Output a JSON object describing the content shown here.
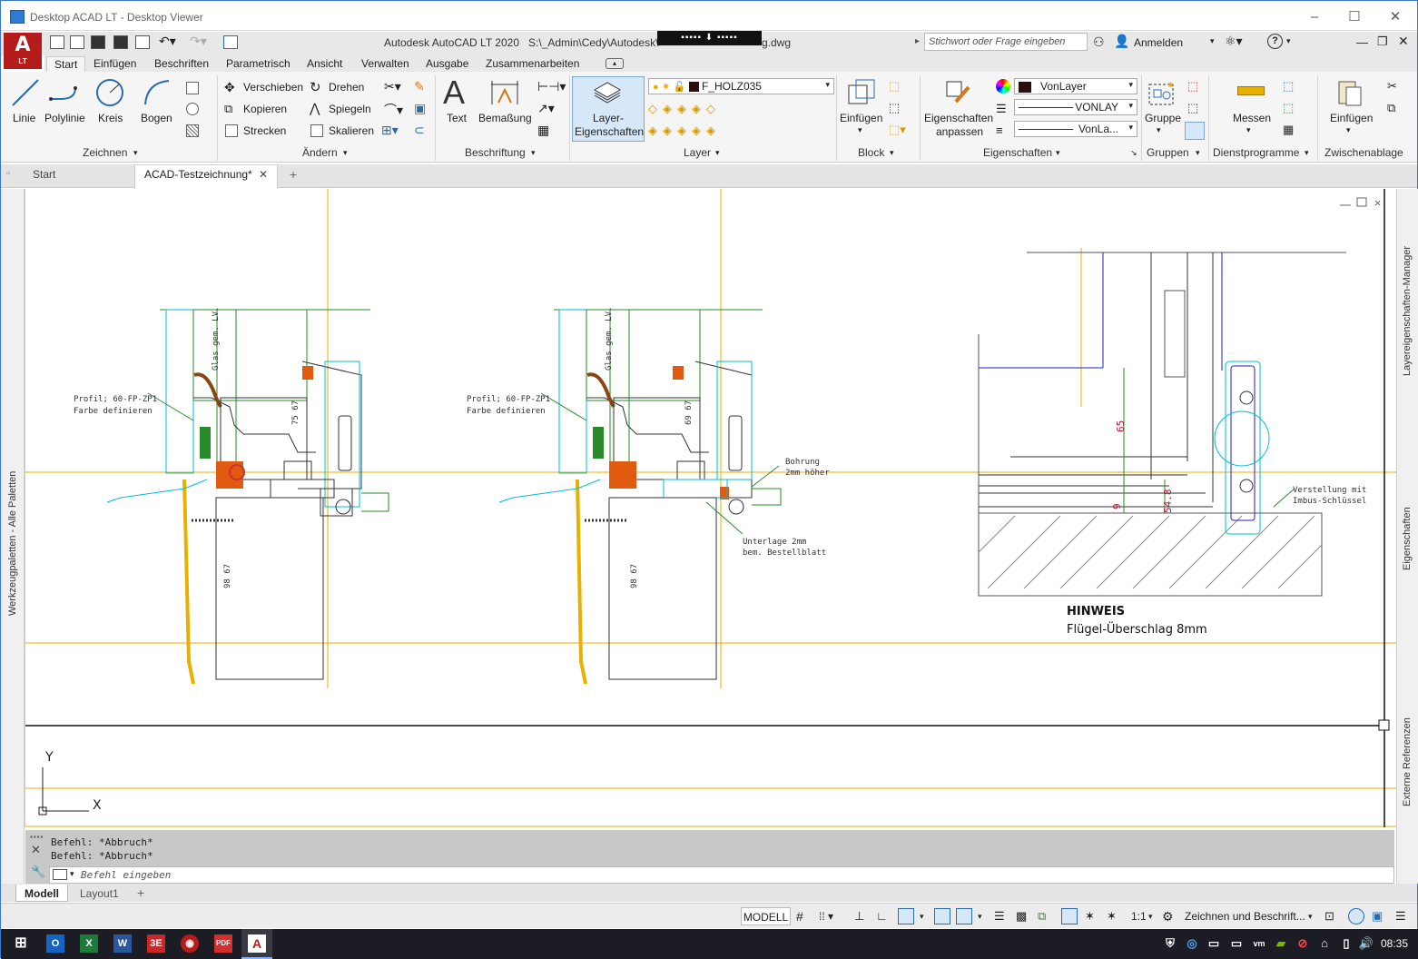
{
  "window": {
    "title": "Desktop ACAD LT - Desktop Viewer"
  },
  "app": {
    "logo_letter": "A",
    "logo_sub": "LT",
    "title": "Autodesk AutoCAD LT 2020",
    "path_left": "S:\\_Admin\\Cedy\\Autodesk\\",
    "path_right": "g.dwg",
    "overlay_bar": "▪▪▪▪▪ ⬇ ▪▪▪▪▪",
    "search_placeholder": "Stichwort oder Frage eingeben",
    "signin": "Anmelden",
    "help": "?"
  },
  "menu_tabs": [
    "Start",
    "Einfügen",
    "Beschriften",
    "Parametrisch",
    "Ansicht",
    "Verwalten",
    "Ausgabe",
    "Zusammenarbeiten"
  ],
  "ribbon": {
    "draw": {
      "items": [
        "Linie",
        "Polylinie",
        "Kreis",
        "Bogen"
      ],
      "panel": "Zeichnen"
    },
    "modify": {
      "items": [
        "Verschieben",
        "Drehen",
        "Kopieren",
        "Spiegeln",
        "Strecken",
        "Skalieren"
      ],
      "panel": "Ändern"
    },
    "annotation": {
      "items": [
        "Text",
        "Bemaßung"
      ],
      "panel": "Beschriftung"
    },
    "layer": {
      "button_line1": "Layer-",
      "button_line2": "Eigenschaften",
      "current_layer": "F_HOLZ035",
      "panel": "Layer"
    },
    "block": {
      "item": "Einfügen",
      "panel": "Block"
    },
    "properties": {
      "button_line1": "Eigenschaften",
      "button_line2": "anpassen",
      "color": "VonLayer",
      "linetype": "VONLAY",
      "lineweight": "VonLa...",
      "panel": "Eigenschaften"
    },
    "groups": {
      "item": "Gruppe",
      "panel": "Gruppen"
    },
    "utilities": {
      "item": "Messen",
      "panel": "Dienstprogramme"
    },
    "clipboard": {
      "item": "Einfügen",
      "panel": "Zwischenablage"
    }
  },
  "doc_tabs": [
    "Start",
    "ACAD-Testzeichnung*"
  ],
  "palettes": {
    "left": "Werkzeugpaletten - Alle Paletten",
    "right1": "Layereigenschaften-Manager",
    "right2": "Eigenschaften",
    "right3": "Externe Referenzen"
  },
  "drawing": {
    "glas1": "Glas gem. LV.",
    "glas2": "Glas gem. LV.",
    "profil_l1": "Profil; 60-FP-ZP1",
    "profil_l2": "Farbe definieren",
    "profil2_l1": "Profil; 60-FP-ZP1",
    "profil2_l2": "Farbe definieren",
    "bohrung_l1": "Bohrung",
    "bohrung_l2": "2mm höher",
    "unterlage_l1": "Unterlage 2mm",
    "unterlage_l2": "bem. Bestellblatt",
    "verstellung_l1": "Verstellung mit",
    "verstellung_l2": "Imbus-Schlüssel",
    "dim_65": "65",
    "dim_9": "9",
    "dim_548": "54.8",
    "hinweis_title": "HINWEIS",
    "hinweis_text": "Flügel-Überschlag 8mm",
    "dim_75_67": "75 67",
    "dim_69_67": "69 67",
    "dim_98_a": "98 67",
    "dim_98_b": "98 67",
    "axis_x": "X",
    "axis_y": "Y"
  },
  "command": {
    "history": [
      "Befehl: *Abbruch*",
      "Befehl: *Abbruch*"
    ],
    "placeholder": "Befehl eingeben"
  },
  "layout_tabs": [
    "Modell",
    "Layout1"
  ],
  "status": {
    "mode": "MODELL",
    "scale": "1:1",
    "workspace": "Zeichnen und Beschrift..."
  },
  "taskbar": {
    "time": "08:35"
  }
}
